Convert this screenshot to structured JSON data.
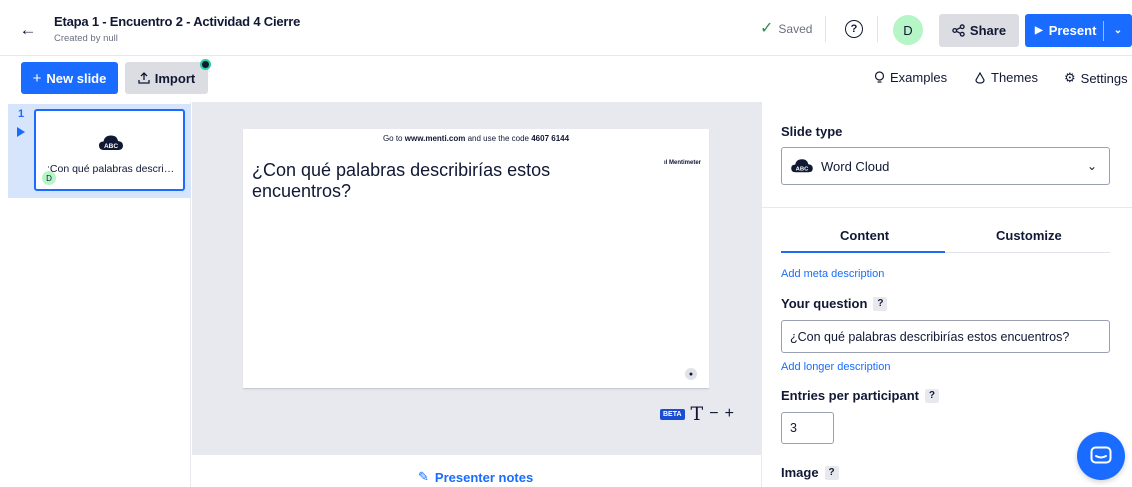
{
  "header": {
    "title": "Etapa 1 - Encuentro 2 - Actividad 4 Cierre",
    "subtitle": "Created by null",
    "saved_label": "Saved",
    "avatar_initial": "D",
    "share_label": "Share",
    "present_label": "Present"
  },
  "toolbar": {
    "new_slide_label": "New slide",
    "import_label": "Import",
    "examples_label": "Examples",
    "themes_label": "Themes",
    "settings_label": "Settings"
  },
  "rail": {
    "slide_number": "1",
    "thumb_text": ";Con qué palabras descri…",
    "thumb_avatar": "D"
  },
  "slide": {
    "code_prefix": "Go to",
    "code_url": "www.menti.com",
    "code_middle": "and use the code",
    "code_value": "4607 6144",
    "logo": "Mentimeter",
    "question": "¿Con qué palabras describirías estos encuentros?"
  },
  "canvas_tools": {
    "beta_label": "BETA",
    "text_icon": "T",
    "zoom_out": "−",
    "zoom_in": "+"
  },
  "notes_label": "Presenter notes",
  "panel": {
    "slide_type_label": "Slide type",
    "slide_type_value": "Word Cloud",
    "tabs": [
      "Content",
      "Customize"
    ],
    "meta_link": "Add meta description",
    "question_label": "Your question",
    "question_value": "¿Con qué palabras describirías estos encuentros?",
    "longer_link": "Add longer description",
    "entries_label": "Entries per participant",
    "entries_value": "3",
    "image_label": "Image",
    "help_mark": "?"
  },
  "colors": {
    "accent": "#196cff",
    "avatar": "#b6f5c6",
    "canvas_bg": "#e8e9ee"
  },
  "icons": [
    "back-arrow-icon",
    "check-icon",
    "help-icon",
    "share-icon",
    "play-icon",
    "plus-icon",
    "upload-icon",
    "bulb-icon",
    "drop-icon",
    "gear-icon",
    "word-cloud-icon",
    "pencil-icon",
    "chevron-down-icon",
    "chat-icon"
  ]
}
